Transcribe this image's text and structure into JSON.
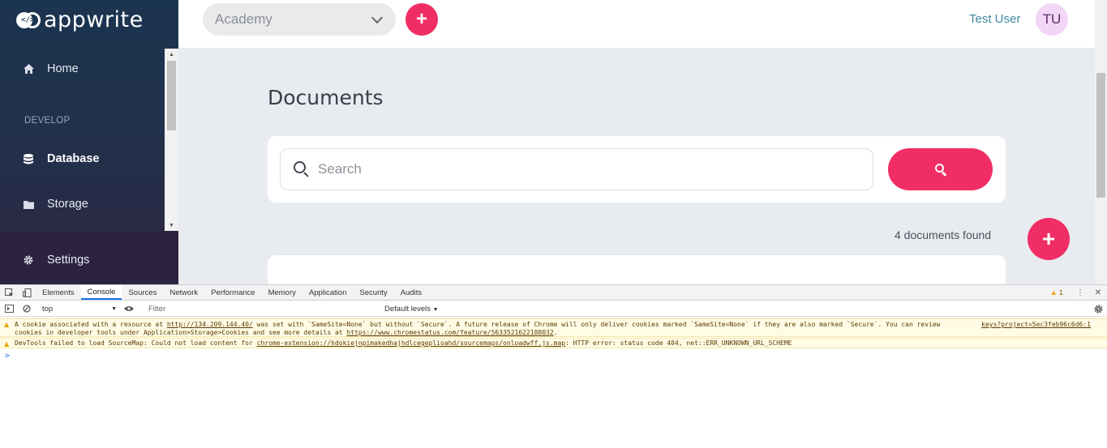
{
  "app": {
    "logo_text": "appwrite"
  },
  "sidebar": {
    "items": [
      {
        "label": "Home",
        "icon": "home-icon"
      },
      {
        "label": "Database",
        "icon": "database-icon"
      },
      {
        "label": "Storage",
        "icon": "folder-icon"
      },
      {
        "label": "Settings",
        "icon": "gear-icon"
      }
    ],
    "section_develop": "DEVELOP",
    "active": "Database"
  },
  "header": {
    "project": "Academy",
    "add_icon": "plus-icon",
    "user_name": "Test User",
    "avatar_initials": "TU"
  },
  "main": {
    "title": "Documents",
    "search_placeholder": "Search",
    "count_text": "4 documents found"
  },
  "devtools": {
    "tabs": [
      "Elements",
      "Console",
      "Sources",
      "Network",
      "Performance",
      "Memory",
      "Application",
      "Security",
      "Audits"
    ],
    "active_tab": "Console",
    "warnings_count": "1",
    "context": "top",
    "filter_placeholder": "Filter",
    "levels": "Default levels",
    "messages": [
      {
        "line1_pre": "A cookie associated with a resource at ",
        "line1_link": "http://134.209.144.40/",
        "line1_post": " was set with `SameSite=None` but without `Secure`. A future release of Chrome will only deliver cookies marked `SameSite=None` if they are also marked `Secure`. You can review",
        "line2_pre": "cookies in developer tools under Application>Storage>Cookies and see more details at ",
        "line2_link": "https://www.chromestatus.com/feature/5633521622188032",
        "line2_post": ".",
        "source": "keys?project=5ec3feb96c6d6:1"
      },
      {
        "pre": "DevTools failed to load SourceMap: Could not load content for ",
        "link": "chrome-extension://hdokiejnpimakedhajhdlcegeplioahd/sourcemaps/onloadwff.js.map",
        "post": ": HTTP error: status code 404, net::ERR_UNKNOWN_URL_SCHEME"
      }
    ],
    "prompt": ">"
  },
  "colors": {
    "accent": "#f02e65",
    "sidebar_top": "#1b3450",
    "link": "#3d87a3"
  }
}
